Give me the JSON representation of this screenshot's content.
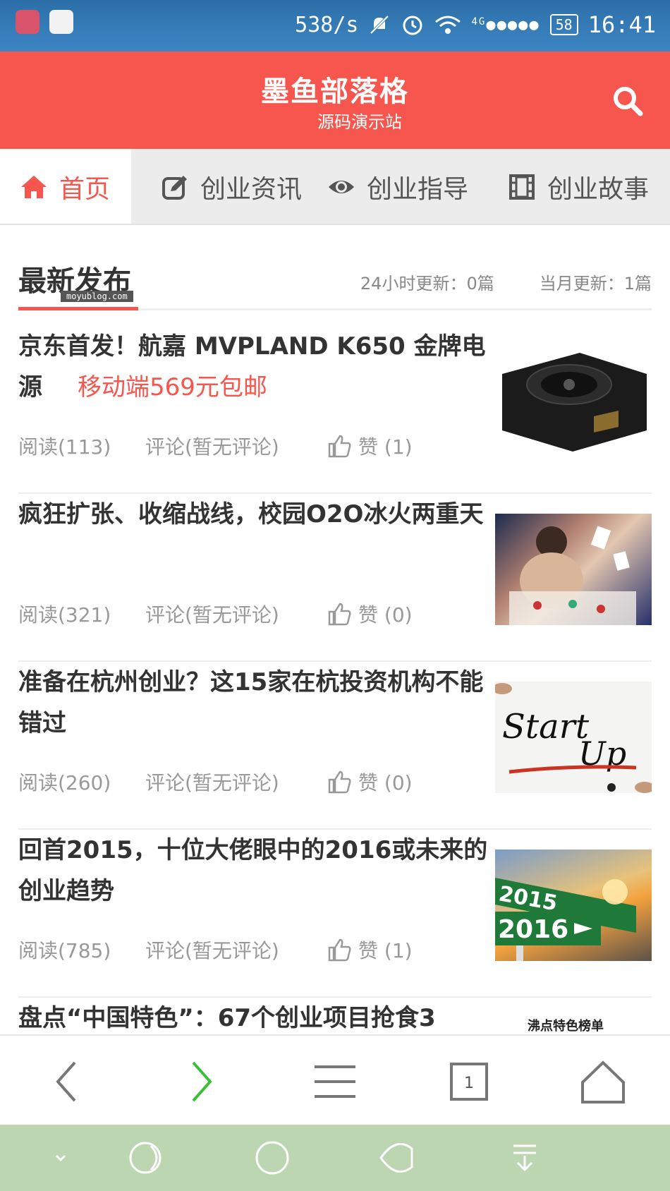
{
  "status_bar": {
    "speed": "538/s",
    "network": "4G",
    "signal": "●●●●●",
    "battery": "58",
    "time": "16:41"
  },
  "header": {
    "title": "墨鱼部落格",
    "subtitle": "源码演示站"
  },
  "nav": {
    "tabs": [
      {
        "label": "首页",
        "icon": "home-icon"
      },
      {
        "label": "创业资讯",
        "icon": "edit-icon"
      },
      {
        "label": "创业指导",
        "icon": "eye-icon"
      },
      {
        "label": "创业故事",
        "icon": "film-icon"
      }
    ]
  },
  "section": {
    "title": "最新发布",
    "watermark": "moyublog.com",
    "stat_24h": "24小时更新：0篇",
    "stat_month": "当月更新：1篇"
  },
  "articles": [
    {
      "title": "京东首发！航嘉 MVPLAND K650 金牌电源",
      "promo": "移动端569元包邮",
      "read": "阅读(113)",
      "comment": "评论(暂无评论)",
      "like": "赞 (1)",
      "thumb": "power-supply-image"
    },
    {
      "title": "疯狂扩张、收缩战线，校园O2O冰火两重天",
      "promo": "",
      "read": "阅读(321)",
      "comment": "评论(暂无评论)",
      "like": "赞 (0)",
      "thumb": "students-image"
    },
    {
      "title": "准备在杭州创业？这15家在杭投资机构不能错过",
      "promo": "",
      "read": "阅读(260)",
      "comment": "评论(暂无评论)",
      "like": "赞 (0)",
      "thumb": "startup-image",
      "thumb_text_1": "Start",
      "thumb_text_2": "Up"
    },
    {
      "title": "回首2015，十位大佬眼中的2016或未来的创业趋势",
      "promo": "",
      "read": "阅读(785)",
      "comment": "评论(暂无评论)",
      "like": "赞 (1)",
      "thumb": "road-sign-image",
      "thumb_text_1": "2015",
      "thumb_text_2": "2016"
    },
    {
      "title": "盘点“中国特色”：67个创业项目抢食3",
      "promo": "",
      "thumb": "ranking-image",
      "thumb_text_1": "沸点特色榜单"
    }
  ],
  "colors": {
    "accent": "#f6564d",
    "status_bar": "#3d86c4",
    "android_bar": "#bcd6b2"
  }
}
